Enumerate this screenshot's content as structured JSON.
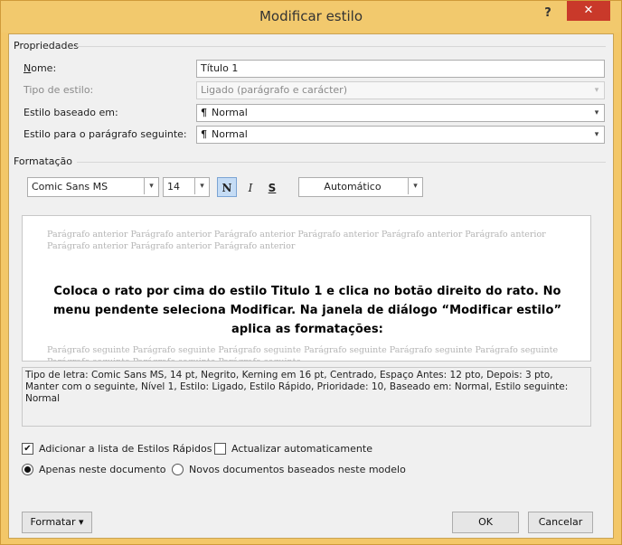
{
  "window": {
    "title": "Modificar estilo",
    "help_label": "?",
    "close_label": "✕"
  },
  "properties": {
    "group_label": "Propriedades",
    "name_label": "Nome:",
    "name_value": "Título 1",
    "type_label": "Tipo de estilo:",
    "type_value": "Ligado (parágrafo e carácter)",
    "based_label": "Estilo baseado em:",
    "based_value": "Normal",
    "next_label": "Estilo para o parágrafo seguinte:",
    "next_value": "Normal",
    "pilcrow": "¶"
  },
  "formatting": {
    "group_label": "Formatação",
    "font": "Comic Sans MS",
    "size": "14",
    "bold": "N",
    "italic": "I",
    "underline": "S",
    "color": "Automático"
  },
  "preview": {
    "previous_paragraph": "Parágrafo anterior Parágrafo anterior Parágrafo anterior Parágrafo anterior Parágrafo anterior Parágrafo anterior Parágrafo anterior Parágrafo anterior Parágrafo anterior",
    "sample_text": "Coloca o rato por cima do estilo Titulo 1 e clica no botão direito do rato. No menu pendente seleciona Modificar. Na janela de diálogo “Modificar estilo” aplica as formatações:",
    "next_paragraph": "Parágrafo seguinte Parágrafo seguinte Parágrafo seguinte Parágrafo seguinte Parágrafo seguinte Parágrafo seguinte Parágrafo seguinte Parágrafo seguinte Parágrafo seguinte"
  },
  "description": "Tipo de letra: Comic Sans MS, 14 pt, Negrito, Kerning em 16 pt, Centrado, Espaço Antes:  12 pto, Depois:  3 pto, Manter com o seguinte, Nível 1, Estilo: Ligado, Estilo Rápido, Prioridade: 10, Baseado em: Normal, Estilo seguinte: Normal",
  "options": {
    "add_quick_styles": "Adicionar a lista de Estilos Rápidos",
    "add_quick_styles_checked": true,
    "auto_update": "Actualizar automaticamente",
    "auto_update_checked": false,
    "only_this_document": "Apenas neste documento",
    "only_this_document_selected": true,
    "new_documents": "Novos documentos baseados neste modelo",
    "new_documents_selected": false
  },
  "buttons": {
    "format": "Formatar ▾",
    "ok": "OK",
    "cancel": "Cancelar"
  },
  "colors": {
    "title_bar": "#f2c96d",
    "close_button": "#c9392a",
    "active_toggle": "#c5dcf5"
  }
}
